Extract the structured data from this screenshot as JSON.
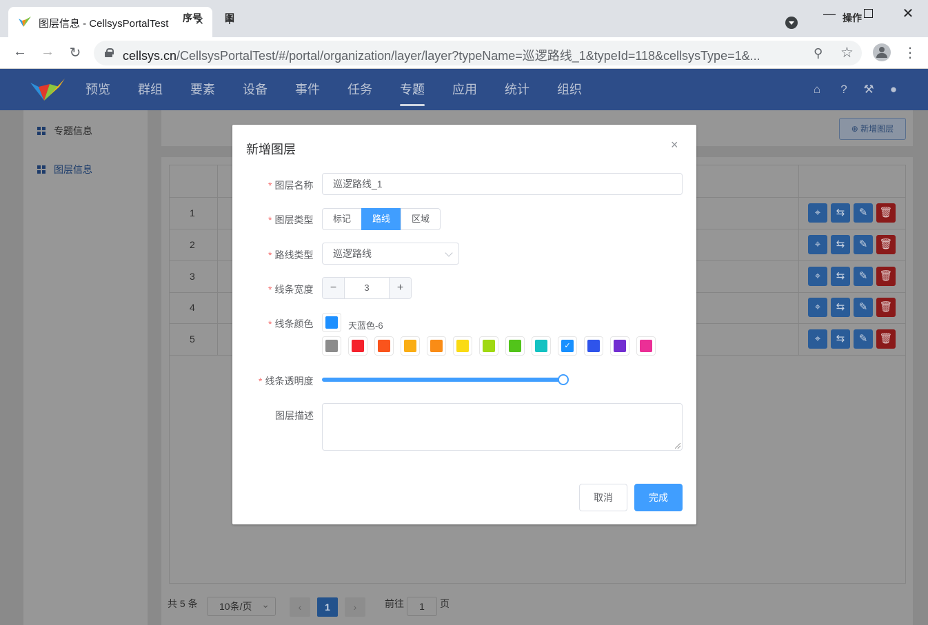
{
  "browser": {
    "tab_title": "图层信息 - CellsysPortalTest",
    "tab_close": "✕",
    "new_tab": "+",
    "url_host": "cellsys.cn",
    "url_path": "/CellsysPortalTest/#/portal/organization/layer/layer?typeName=巡逻路线_1&typeId=118&cellsysType=1&..."
  },
  "app": {
    "nav": [
      "预览",
      "群组",
      "要素",
      "设备",
      "事件",
      "任务",
      "专题",
      "应用",
      "统计",
      "组织"
    ],
    "active_nav": "专题",
    "header_icons": [
      "home-icon",
      "help-icon",
      "tools-icon",
      "user-icon"
    ]
  },
  "sidebar": {
    "items": [
      {
        "label": "专题信息",
        "icon": "grid-icon"
      },
      {
        "label": "图层信息",
        "icon": "grid-icon",
        "active": true
      }
    ]
  },
  "page": {
    "new_layer_button": "⊕ 新增图层",
    "table": {
      "headers": {
        "index": "序号",
        "name_partial": "图",
        "actions": "操作"
      },
      "rows": [
        "1",
        "2",
        "3",
        "4",
        "5"
      ],
      "row_actions": [
        "map-edit-icon",
        "swap-icon",
        "edit-icon",
        "delete-icon"
      ]
    },
    "pagination": {
      "total": "共 5 条",
      "page_size": "10条/页",
      "prev": "‹",
      "current": "1",
      "next": "›",
      "goto_label": "前往",
      "goto_value": "1",
      "page_unit": "页"
    }
  },
  "modal": {
    "title": "新增图层",
    "close": "×",
    "fields": {
      "layer_name": {
        "label": "图层名称",
        "value": "巡逻路线_1"
      },
      "layer_type": {
        "label": "图层类型",
        "options": [
          "标记",
          "路线",
          "区域"
        ],
        "selected": "路线"
      },
      "route_type": {
        "label": "路线类型",
        "value": "巡逻路线"
      },
      "line_width": {
        "label": "线条宽度",
        "value": "3",
        "minus": "−",
        "plus": "+"
      },
      "line_color": {
        "label": "线条颜色",
        "current_color": "#1e90ff",
        "current_name": "天蓝色-6",
        "palette": [
          "#8c8c8c",
          "#f5222d",
          "#fa541c",
          "#faad14",
          "#fa8c16",
          "#fadb14",
          "#a0d911",
          "#52c41a",
          "#13c2c2",
          "#1890ff",
          "#2f54eb",
          "#722ed1",
          "#eb2f96"
        ],
        "selected_index": 9,
        "check": "✓"
      },
      "line_opacity": {
        "label": "线条透明度",
        "value_percent": 100
      },
      "description": {
        "label": "图层描述",
        "value": ""
      }
    },
    "buttons": {
      "cancel": "取消",
      "ok": "完成"
    }
  }
}
